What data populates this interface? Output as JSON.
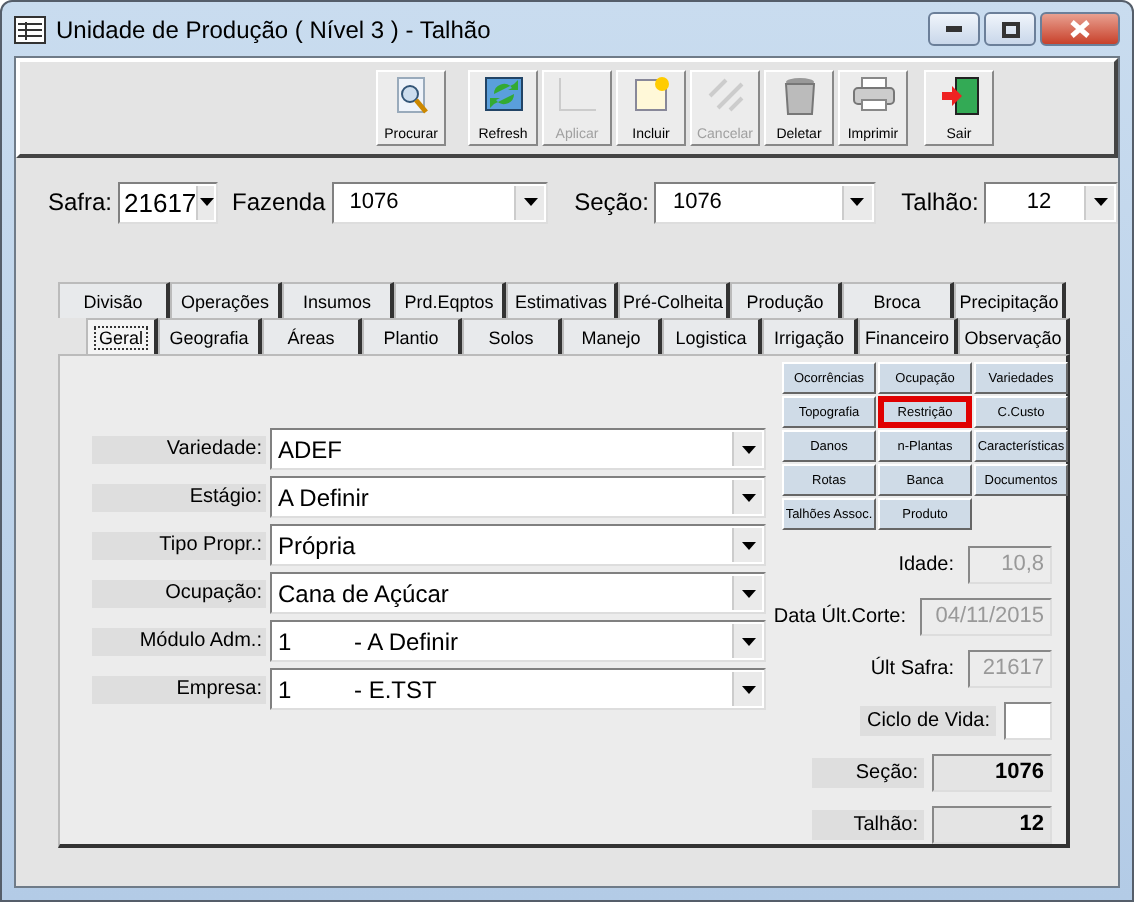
{
  "window": {
    "title": "Unidade de Produção ( Nível 3 ) - Talhão"
  },
  "toolbar": [
    {
      "label": "Procurar",
      "disabled": false
    },
    {
      "label": "Refresh",
      "disabled": false
    },
    {
      "label": "Aplicar",
      "disabled": true
    },
    {
      "label": "Incluir",
      "disabled": false
    },
    {
      "label": "Cancelar",
      "disabled": true
    },
    {
      "label": "Deletar",
      "disabled": false
    },
    {
      "label": "Imprimir",
      "disabled": false
    },
    {
      "label": "Sair",
      "disabled": false
    }
  ],
  "filters": [
    {
      "label": "Safra:",
      "value": "21617"
    },
    {
      "label": "Fazenda",
      "value": "1076"
    },
    {
      "label": "Seção:",
      "value": "1076"
    },
    {
      "label": "Talhão:",
      "value": "12"
    }
  ],
  "tabs_row_1": [
    {
      "label": "Divisão",
      "selected": false
    },
    {
      "label": "Operações",
      "selected": false
    },
    {
      "label": "Insumos",
      "selected": false
    },
    {
      "label": "Prd.Eqptos",
      "selected": false
    },
    {
      "label": "Estimativas",
      "selected": false
    },
    {
      "label": "Pré-Colheita",
      "selected": false
    },
    {
      "label": "Produção",
      "selected": false
    },
    {
      "label": "Broca",
      "selected": false
    },
    {
      "label": "Precipitação",
      "selected": false
    }
  ],
  "tabs_row_2": [
    {
      "label": "Geral",
      "selected": true
    },
    {
      "label": "Geografia",
      "selected": false
    },
    {
      "label": "Áreas",
      "selected": false
    },
    {
      "label": "Plantio",
      "selected": false
    },
    {
      "label": "Solos",
      "selected": false
    },
    {
      "label": "Manejo",
      "selected": false
    },
    {
      "label": "Logistica",
      "selected": false
    },
    {
      "label": "Irrigação",
      "selected": false
    },
    {
      "label": "Financeiro",
      "selected": false
    },
    {
      "label": "Observação",
      "selected": false
    }
  ],
  "fields": [
    {
      "label": "Variedade:",
      "value": "ADEF"
    },
    {
      "label": "Estágio:",
      "value": "A Definir"
    },
    {
      "label": "Tipo Propr.:",
      "value": "Própria"
    },
    {
      "label": "Ocupação:",
      "value": "Cana de Açúcar"
    },
    {
      "label": "Módulo Adm.:",
      "code": "1",
      "value": "- A Definir"
    },
    {
      "label": "Empresa:",
      "code": "1",
      "value": "- E.TST"
    }
  ],
  "detail_buttons": [
    {
      "label": "Ocorrências",
      "selected": false
    },
    {
      "label": "Ocupação",
      "selected": false
    },
    {
      "label": "Variedades",
      "selected": false
    },
    {
      "label": "Topografia",
      "selected": false
    },
    {
      "label": "Restrição",
      "selected": true
    },
    {
      "label": "C.Custo",
      "selected": false
    },
    {
      "label": "Danos",
      "selected": false
    },
    {
      "label": "n-Plantas",
      "selected": false
    },
    {
      "label": "Características",
      "selected": false
    },
    {
      "label": "Rotas",
      "selected": false
    },
    {
      "label": "Banca",
      "selected": false
    },
    {
      "label": "Documentos",
      "selected": false
    },
    {
      "label": "Talhões Assoc.",
      "selected": false
    },
    {
      "label": "Produto",
      "selected": false
    }
  ],
  "info": [
    {
      "kind": "readonly",
      "label": "Idade:",
      "value": "10,8"
    },
    {
      "kind": "readonly",
      "label": "Data Últ.Corte:",
      "value": "04/11/2015"
    },
    {
      "kind": "readonly",
      "label": "Últ Safra:",
      "value": "21617"
    },
    {
      "kind": "edit",
      "label": "Ciclo de Vida:"
    },
    {
      "kind": "total",
      "label": "Seção:",
      "value": "1076"
    },
    {
      "kind": "total",
      "label": "Talhão:",
      "value": "12"
    }
  ]
}
